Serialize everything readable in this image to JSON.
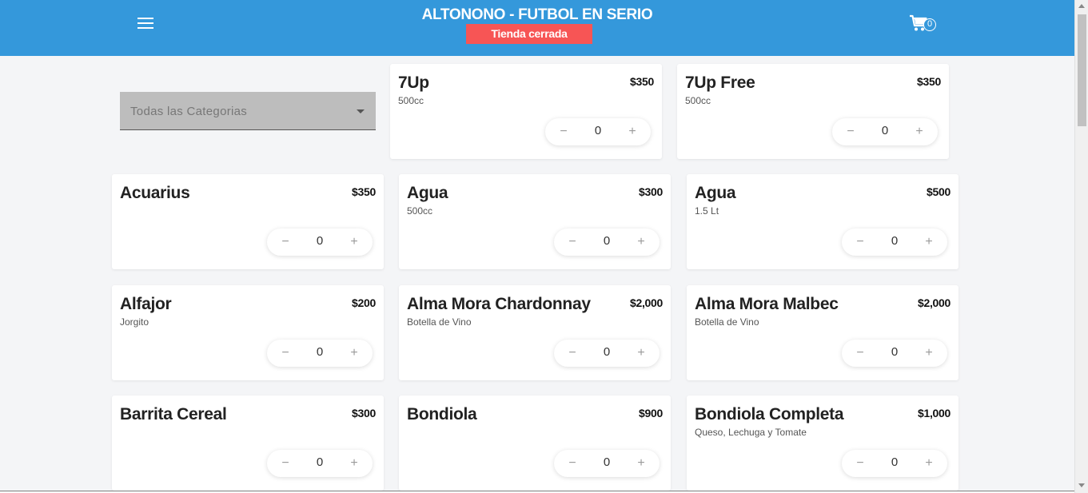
{
  "header": {
    "title": "ALTONONO - FUTBOL EN SERIO",
    "status": "Tienda cerrada",
    "cart_count": "0",
    "menu_icon": "hamburger-menu-icon",
    "cart_icon": "shopping-cart-icon"
  },
  "colors": {
    "header_bg": "#3498db",
    "status_bg": "#f75555",
    "page_bg": "#f4f5f7"
  },
  "filter": {
    "category_placeholder": "Todas las Categorias"
  },
  "products": [
    {
      "name": "7Up",
      "price": "$350",
      "desc": "500cc",
      "qty": "0",
      "minus": "−",
      "plus": "+"
    },
    {
      "name": "7Up Free",
      "price": "$350",
      "desc": "500cc",
      "qty": "0",
      "minus": "−",
      "plus": "+"
    },
    {
      "name": "Acuarius",
      "price": "$350",
      "desc": "",
      "qty": "0",
      "minus": "−",
      "plus": "+"
    },
    {
      "name": "Agua",
      "price": "$300",
      "desc": "500cc",
      "qty": "0",
      "minus": "−",
      "plus": "+"
    },
    {
      "name": "Agua",
      "price": "$500",
      "desc": "1.5 Lt",
      "qty": "0",
      "minus": "−",
      "plus": "+"
    },
    {
      "name": "Alfajor",
      "price": "$200",
      "desc": "Jorgito",
      "qty": "0",
      "minus": "−",
      "plus": "+"
    },
    {
      "name": "Alma Mora Chardonnay",
      "price": "$2,000",
      "desc": "Botella de Vino",
      "qty": "0",
      "minus": "−",
      "plus": "+"
    },
    {
      "name": "Alma Mora Malbec",
      "price": "$2,000",
      "desc": "Botella de Vino",
      "qty": "0",
      "minus": "−",
      "plus": "+"
    },
    {
      "name": "Barrita Cereal",
      "price": "$300",
      "desc": "",
      "qty": "0",
      "minus": "−",
      "plus": "+"
    },
    {
      "name": "Bondiola",
      "price": "$900",
      "desc": "",
      "qty": "0",
      "minus": "−",
      "plus": "+"
    },
    {
      "name": "Bondiola Completa",
      "price": "$1,000",
      "desc": "Queso, Lechuga y Tomate",
      "qty": "0",
      "minus": "−",
      "plus": "+"
    }
  ]
}
